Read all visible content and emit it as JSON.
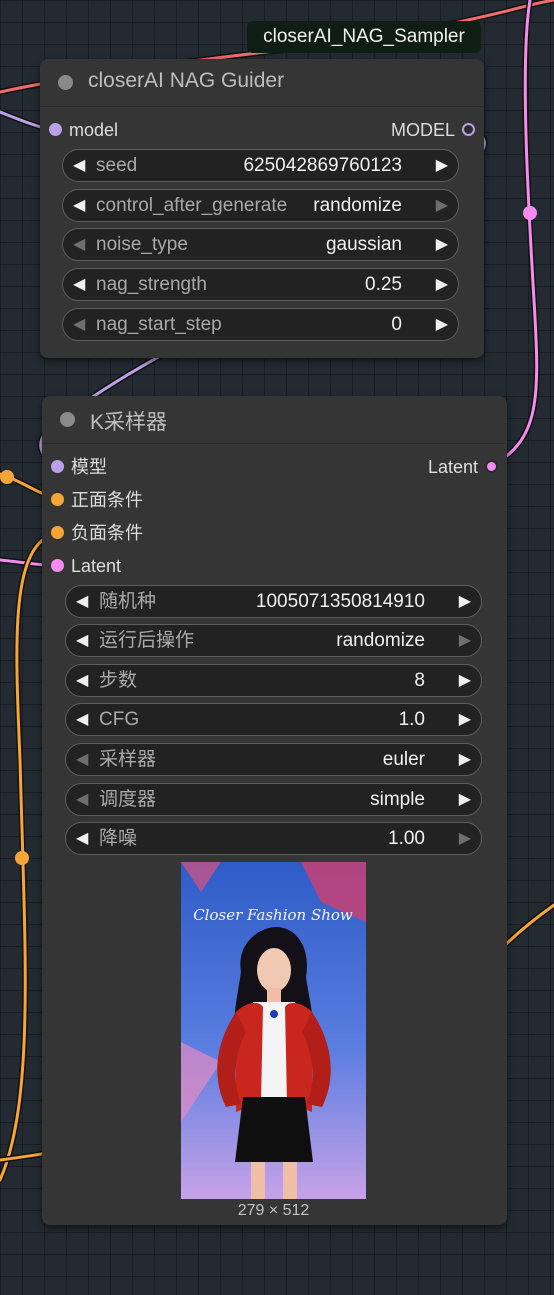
{
  "canvas": {
    "accent_wire_pink": "#f48cf0",
    "accent_wire_orange": "#f6a537",
    "accent_wire_red": "#ef6b6f",
    "accent_wire_purple": "#b9a1e8"
  },
  "floating_tag": "closerAI_NAG_Sampler",
  "nag_node": {
    "title": "closerAI NAG Guider",
    "inputs": [
      {
        "label": "model",
        "color": "#b9a1e8"
      }
    ],
    "outputs": [
      {
        "label": "MODEL",
        "color": "#b9a1e8"
      }
    ],
    "widgets": [
      {
        "label": "seed",
        "value": "625042869760123",
        "left_dim": false,
        "right_dim": false
      },
      {
        "label": "control_after_generate",
        "value": "randomize",
        "left_dim": false,
        "right_dim": true
      },
      {
        "label": "noise_type",
        "value": "gaussian",
        "left_dim": true,
        "right_dim": false
      },
      {
        "label": "nag_strength",
        "value": "0.25",
        "left_dim": false,
        "right_dim": false
      },
      {
        "label": "nag_start_step",
        "value": "0",
        "left_dim": true,
        "right_dim": false
      }
    ]
  },
  "ksampler_node": {
    "title": "K采样器",
    "inputs": [
      {
        "label": "模型",
        "color": "#b9a1e8"
      },
      {
        "label": "正面条件",
        "color": "#f6a537"
      },
      {
        "label": "负面条件",
        "color": "#f6a537"
      },
      {
        "label": "Latent",
        "color": "#f48cf0"
      }
    ],
    "outputs": [
      {
        "label": "Latent",
        "color": "#f48cf0"
      }
    ],
    "widgets": [
      {
        "label": "随机种",
        "value": "1005071350814910",
        "left_dim": false,
        "right_dim": false
      },
      {
        "label": "运行后操作",
        "value": "randomize",
        "left_dim": false,
        "right_dim": true
      },
      {
        "label": "步数",
        "value": "8",
        "left_dim": false,
        "right_dim": false
      },
      {
        "label": "CFG",
        "value": "1.0",
        "left_dim": false,
        "right_dim": false
      },
      {
        "label": "采样器",
        "value": "euler",
        "left_dim": true,
        "right_dim": false
      },
      {
        "label": "调度器",
        "value": "simple",
        "left_dim": true,
        "right_dim": false
      },
      {
        "label": "降噪",
        "value": "1.00",
        "left_dim": false,
        "right_dim": true
      }
    ],
    "preview": {
      "image_text": "Closer Fashion Show",
      "dimensions": "279 × 512"
    }
  }
}
